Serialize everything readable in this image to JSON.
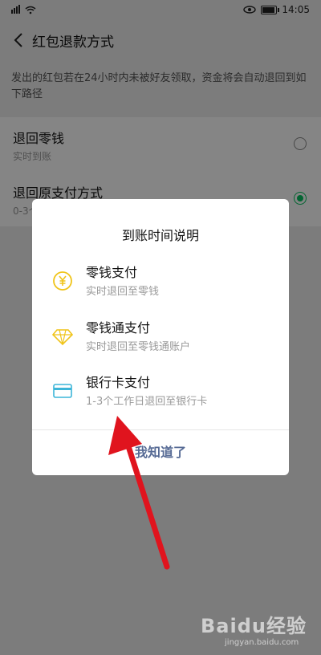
{
  "status": {
    "signal_text": "⁴ᴳ ᵢₗₗ",
    "time": "14:05"
  },
  "nav": {
    "title": "红包退款方式"
  },
  "notice": "发出的红包若在24小时内未被好友领取，资金将会自动退回到如下路径",
  "options": [
    {
      "title": "退回零钱",
      "subtitle": "实时到账",
      "selected": false
    },
    {
      "title": "退回原支付方式",
      "subtitle": "0-3个工作日",
      "selected": true
    }
  ],
  "dialog": {
    "title": "到账时间说明",
    "items": [
      {
        "icon": "coin-icon",
        "title": "零钱支付",
        "subtitle": "实时退回至零钱",
        "color": "#f0c419"
      },
      {
        "icon": "diamond-icon",
        "title": "零钱通支付",
        "subtitle": "实时退回至零钱通账户",
        "color": "#f0c419"
      },
      {
        "icon": "bank-card-icon",
        "title": "银行卡支付",
        "subtitle": "1-3个工作日退回至银行卡",
        "color": "#3cb5d8"
      }
    ],
    "confirm_label": "我知道了"
  },
  "watermark": {
    "brand": "Baidu经验",
    "url": "jingyan.baidu.com"
  },
  "colors": {
    "accent_green": "#07c160",
    "link_blue": "#576b95",
    "annotation_red": "#e0141e"
  }
}
